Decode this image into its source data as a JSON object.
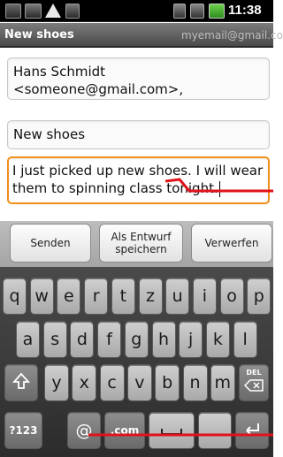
{
  "status_bar": {
    "time": "11:38",
    "icons": [
      "usb-icon",
      "gmail-notification-icon",
      "warning-icon",
      "android-icon",
      "wifi-icon",
      "signal-icon",
      "battery-icon"
    ]
  },
  "title_bar": {
    "title": "New shoes",
    "account": "myemail@gmail.com"
  },
  "compose": {
    "to": "Hans Schmidt <someone@gmail.com>,",
    "subject": "New shoes",
    "body": "I just picked up new shoes. I will wear them to spinning class tonight."
  },
  "actions": {
    "send": "Senden",
    "save_draft": "Als Entwurf speichern",
    "discard": "Verwerfen"
  },
  "keyboard": {
    "row1": [
      "q",
      "w",
      "e",
      "r",
      "t",
      "z",
      "u",
      "i",
      "o",
      "p"
    ],
    "row2": [
      "a",
      "s",
      "d",
      "f",
      "g",
      "h",
      "j",
      "k",
      "l"
    ],
    "row3": [
      "y",
      "x",
      "c",
      "v",
      "b",
      "n",
      "m"
    ],
    "shift_icon": "shift-icon",
    "delete_label": "DEL",
    "symbols_label": "?123",
    "at_label": "@",
    "com_label": ".com",
    "period_label": "."
  },
  "colors": {
    "focus_border": "#f18f1a",
    "annotation": "#e0121a"
  }
}
